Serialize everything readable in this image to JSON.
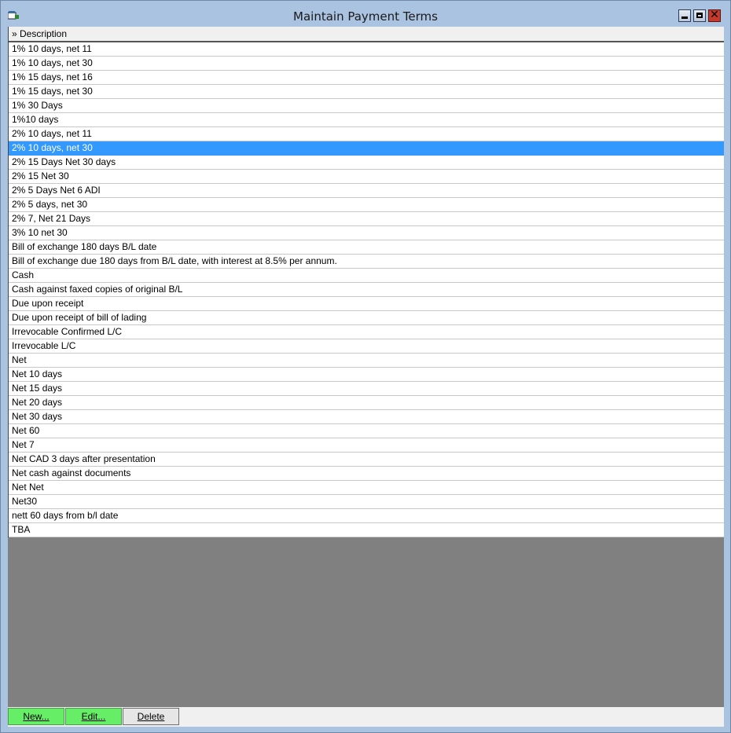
{
  "window": {
    "title": "Maintain Payment Terms"
  },
  "grid": {
    "header": "» Description",
    "selected_index": 7,
    "rows": [
      "1% 10 days, net 11",
      "1% 10 days, net 30",
      "1% 15 days, net 16",
      "1% 15 days, net 30",
      "1% 30 Days",
      "1%10 days",
      "2% 10 days, net 11",
      "2% 10 days, net 30",
      "2% 15 Days Net 30 days",
      "2% 15 Net 30",
      "2% 5 Days Net 6 ADI",
      "2% 5 days, net 30",
      "2% 7, Net 21 Days",
      "3% 10 net 30",
      "Bill of exchange 180 days B/L date",
      "Bill of exchange due 180 days from B/L date, with interest at 8.5% per annum.",
      "Cash",
      "Cash against faxed copies of original B/L",
      "Due upon receipt",
      "Due upon receipt of bill of lading",
      "Irrevocable Confirmed L/C",
      "Irrevocable L/C",
      "Net",
      "Net 10 days",
      "Net 15 days",
      "Net 20 days",
      "Net 30 days",
      "Net 60",
      "Net 7",
      "Net CAD 3 days after presentation",
      "Net cash against documents",
      "Net Net",
      "Net30",
      "nett 60 days from b/l date",
      "TBA"
    ]
  },
  "buttons": {
    "new": "New...",
    "edit": "Edit...",
    "delete": "Delete"
  },
  "colors": {
    "selection": "#3399ff",
    "button_green": "#66ee66",
    "titlebar": "#aac3e0"
  }
}
